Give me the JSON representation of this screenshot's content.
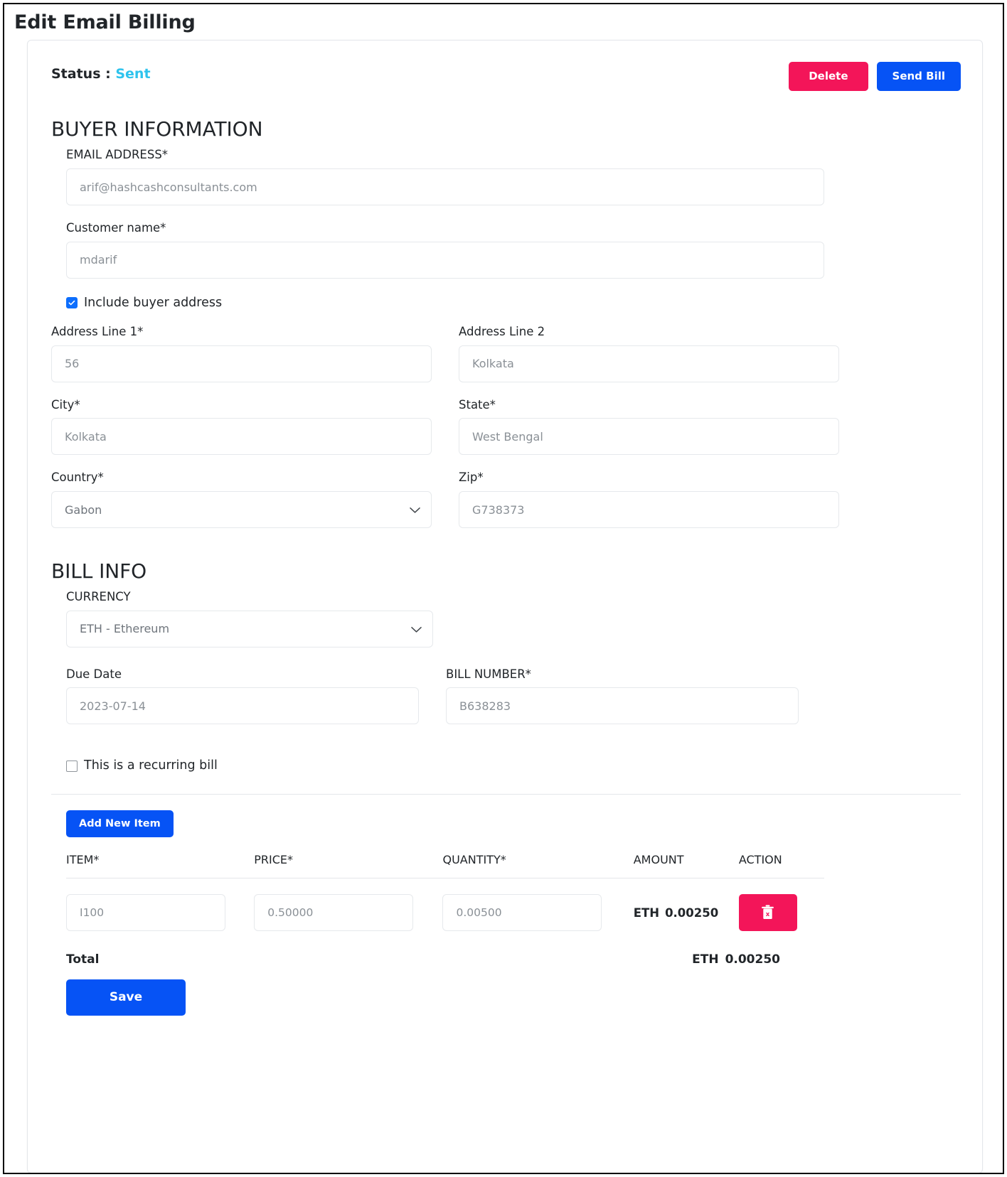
{
  "page": {
    "title": "Edit Email Billing"
  },
  "status": {
    "label": "Status :",
    "value": "Sent",
    "value_color": "#2ec3ed"
  },
  "actions": {
    "delete_label": "Delete",
    "delete_color": "#f31559",
    "send_label": "Send Bill",
    "send_color": "#0653f5"
  },
  "buyer_information": {
    "heading": "BUYER INFORMATION",
    "email": {
      "label": "EMAIL ADDRESS*",
      "value": "arif@hashcashconsultants.com"
    },
    "customer_name": {
      "label": "Customer name*",
      "value": "mdarif"
    },
    "include_buyer_address": {
      "label": "Include buyer address",
      "checked": true
    },
    "address_line_1": {
      "label": "Address Line 1*",
      "value": "56"
    },
    "address_line_2": {
      "label": "Address Line 2",
      "value": "Kolkata"
    },
    "city": {
      "label": "City*",
      "value": "Kolkata"
    },
    "state": {
      "label": "State*",
      "value": "West Bengal"
    },
    "country": {
      "label": "Country*",
      "value": "Gabon"
    },
    "zip": {
      "label": "Zip*",
      "value": "G738373"
    }
  },
  "bill_info": {
    "heading": "BILL INFO",
    "currency": {
      "label": "CURRENCY",
      "value": "ETH - Ethereum"
    },
    "due_date": {
      "label": "Due Date",
      "value": "2023-07-14"
    },
    "bill_number": {
      "label": "BILL NUMBER*",
      "value": "B638283"
    },
    "recurring": {
      "label": "This is a recurring bill",
      "checked": false
    }
  },
  "items": {
    "add_button_label": "Add New Item",
    "columns": [
      "ITEM*",
      "PRICE*",
      "QUANTITY*",
      "AMOUNT",
      "ACTION"
    ],
    "rows": [
      {
        "item": "I100",
        "price": "0.50000",
        "quantity": "0.00500",
        "amount_currency": "ETH",
        "amount_value": "0.00250",
        "action_icon": "trash-icon"
      }
    ],
    "total_label": "Total",
    "total_currency": "ETH",
    "total_value": "0.00250"
  },
  "save": {
    "label": "Save",
    "color": "#0653f5"
  }
}
